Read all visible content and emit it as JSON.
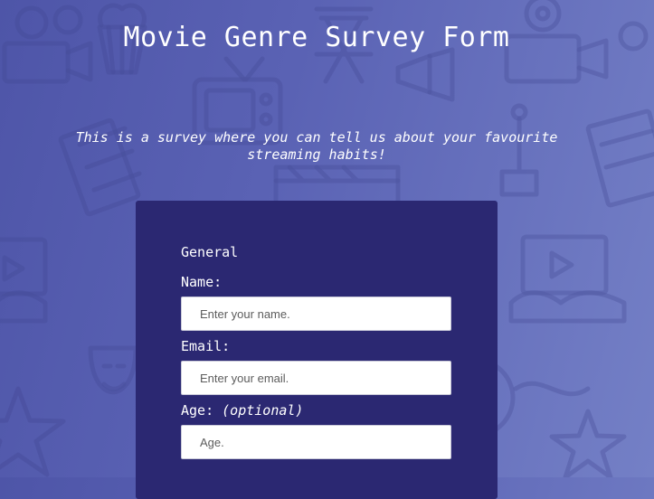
{
  "page": {
    "title": "Movie Genre Survey Form",
    "description": "This is a survey where you can tell us about your favourite streaming habits!"
  },
  "form": {
    "legend": "General",
    "name": {
      "label": "Name:",
      "placeholder": "Enter your name."
    },
    "email": {
      "label": "Email:",
      "placeholder": "Enter your email."
    },
    "age": {
      "label": "Age:",
      "optional": "(optional)",
      "placeholder": "Age."
    }
  },
  "colors": {
    "background_start": "#4e55a8",
    "background_end": "#7480c6",
    "panel": "#2b2872",
    "text": "#ffffff"
  },
  "background_icons": [
    "popcorn-icon",
    "film-camera-icon",
    "clapperboard-icon",
    "director-chair-icon",
    "television-icon",
    "film-strip-icon",
    "ticket-icon",
    "theater-masks-icon",
    "star-icon",
    "megaphone-icon",
    "film-reel-icon",
    "video-player-icon"
  ]
}
